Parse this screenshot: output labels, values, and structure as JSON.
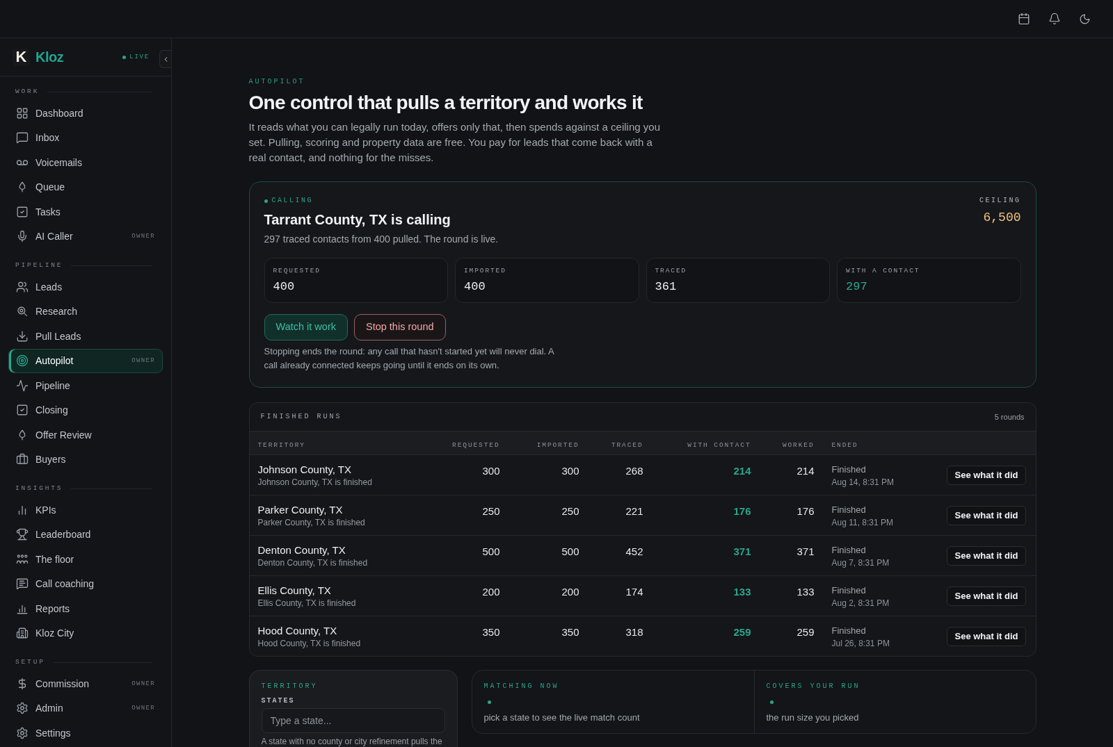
{
  "sidebar": {
    "logo_mark": "K",
    "brand": "Kloz",
    "status": "LIVE",
    "sections": [
      {
        "title": "WORK",
        "items": [
          {
            "label": "Dashboard",
            "selected": false
          },
          {
            "label": "Inbox",
            "selected": false
          },
          {
            "label": "Voicemails",
            "selected": false
          },
          {
            "label": "Queue",
            "selected": false
          },
          {
            "label": "Tasks",
            "selected": false
          },
          {
            "label": "AI Caller",
            "badge": "OWNER",
            "selected": false
          }
        ]
      },
      {
        "title": "PIPELINE",
        "items": [
          {
            "label": "Leads",
            "selected": false
          },
          {
            "label": "Research",
            "selected": false
          },
          {
            "label": "Pull Leads",
            "selected": false
          },
          {
            "label": "Autopilot",
            "badge": "OWNER",
            "selected": true
          },
          {
            "label": "Pipeline",
            "selected": false
          },
          {
            "label": "Closing",
            "selected": false
          },
          {
            "label": "Offer Review",
            "selected": false
          },
          {
            "label": "Buyers",
            "selected": false
          }
        ]
      },
      {
        "title": "INSIGHTS",
        "items": [
          {
            "label": "KPIs",
            "selected": false
          },
          {
            "label": "Leaderboard",
            "selected": false
          },
          {
            "label": "The floor",
            "selected": false
          },
          {
            "label": "Call coaching",
            "selected": false
          },
          {
            "label": "Reports",
            "selected": false
          },
          {
            "label": "Kloz City",
            "selected": false
          }
        ]
      },
      {
        "title": "SETUP",
        "items": [
          {
            "label": "Commission",
            "badge": "OWNER",
            "selected": false
          },
          {
            "label": "Admin",
            "badge": "OWNER",
            "selected": false
          },
          {
            "label": "Settings",
            "selected": false
          }
        ]
      }
    ]
  },
  "page": {
    "eyebrow": "AUTOPILOT",
    "title": "One control that pulls a territory and works it",
    "intro": "It reads what you can legally run today, offers only that, then spends against a ceiling you set. Pulling, scoring and property data are free. You pay for leads that come back with a real contact, and nothing for the misses."
  },
  "active_round": {
    "status": "CALLING",
    "title": "Tarrant County, TX is calling",
    "summary": "297 traced contacts from 400 pulled. The round is live.",
    "ceiling_label": "CEILING",
    "ceiling": "6,500",
    "stats": [
      {
        "label": "REQUESTED",
        "value": "400",
        "accent": false
      },
      {
        "label": "IMPORTED",
        "value": "400",
        "accent": false
      },
      {
        "label": "TRACED",
        "value": "361",
        "accent": false
      },
      {
        "label": "WITH A CONTACT",
        "value": "297",
        "accent": true
      }
    ],
    "actions": [
      {
        "label": "Watch it work",
        "kind": "primary"
      },
      {
        "label": "Stop this round",
        "kind": "danger"
      }
    ],
    "note": "Stopping ends the round: any call that hasn't started yet will never dial. A call already connected keeps going until it ends on its own."
  },
  "finished_runs": {
    "title": "FINISHED RUNS",
    "count": "5 rounds",
    "columns": [
      "TERRITORY",
      "REQUESTED",
      "IMPORTED",
      "TRACED",
      "WITH CONTACT",
      "WORKED",
      "ENDED"
    ],
    "rows": [
      {
        "territory": "Johnson County, TX",
        "detail": "Johnson County, TX is finished",
        "requested": "300",
        "imported": "300",
        "traced": "268",
        "with_contact": "214",
        "worked": "214",
        "status": "Finished",
        "ended": "Aug 14, 8:31 PM",
        "action": "See what it did"
      },
      {
        "territory": "Parker County, TX",
        "detail": "Parker County, TX is finished",
        "requested": "250",
        "imported": "250",
        "traced": "221",
        "with_contact": "176",
        "worked": "176",
        "status": "Finished",
        "ended": "Aug 11, 8:31 PM",
        "action": "See what it did"
      },
      {
        "territory": "Denton County, TX",
        "detail": "Denton County, TX is finished",
        "requested": "500",
        "imported": "500",
        "traced": "452",
        "with_contact": "371",
        "worked": "371",
        "status": "Finished",
        "ended": "Aug 7, 8:31 PM",
        "action": "See what it did"
      },
      {
        "territory": "Ellis County, TX",
        "detail": "Ellis County, TX is finished",
        "requested": "200",
        "imported": "200",
        "traced": "174",
        "with_contact": "133",
        "worked": "133",
        "status": "Finished",
        "ended": "Aug 2, 8:31 PM",
        "action": "See what it did"
      },
      {
        "territory": "Hood County, TX",
        "detail": "Hood County, TX is finished",
        "requested": "350",
        "imported": "350",
        "traced": "318",
        "with_contact": "259",
        "worked": "259",
        "status": "Finished",
        "ended": "Jul 26, 8:31 PM",
        "action": "See what it did"
      }
    ]
  },
  "territory": {
    "title": "TERRITORY",
    "field_label": "STATES",
    "placeholder": "Type a state...",
    "hint": "A state with no county or city refinement pulls the"
  },
  "coverage": [
    {
      "title": "MATCHING NOW",
      "text": "pick a state to see the live match count"
    },
    {
      "title": "COVERS YOUR RUN",
      "text": "the run size you picked"
    }
  ]
}
